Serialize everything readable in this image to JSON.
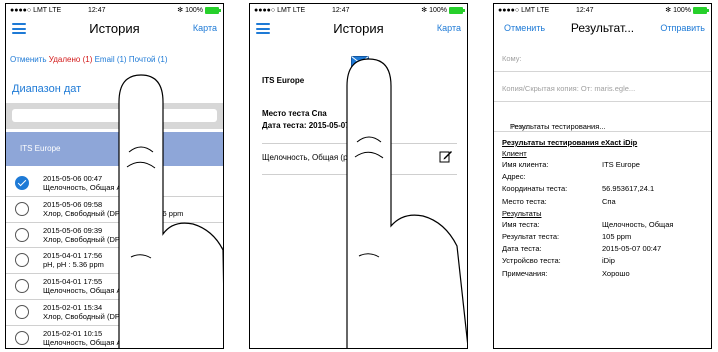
{
  "status": {
    "carrier": "●●●●○ LMT LTE",
    "time": "12:47",
    "bluetooth": "✻",
    "battery": "100%"
  },
  "screen1": {
    "title": "История",
    "map_button": "Карта",
    "filters": {
      "cancel": "Отменить",
      "deleted": "Удалено (1)",
      "email": "Email (1)",
      "mail": "Почтой (1)"
    },
    "date_range": "Диапазон дат",
    "group": "ITS Europe",
    "items": [
      {
        "date": "2015-05-06 00:47",
        "desc": "Щелочность, Общая AL : 105 ppm",
        "checked": true
      },
      {
        "date": "2015-05-06 09:58",
        "desc": "Хлор, Свободный (DPD-1) CL : 5.36 ppm",
        "checked": false
      },
      {
        "date": "2015-05-06 09:39",
        "desc": "Хлор, Свободный (DPD-1) CL : 0.51 ppm",
        "checked": false
      },
      {
        "date": "2015-04-01 17:56",
        "desc": "pH, pH : 5.36 ppm",
        "checked": false
      },
      {
        "date": "2015-04-01 17:55",
        "desc": "Щелочность, Общая AL : 0 ppm",
        "checked": false
      },
      {
        "date": "2015-02-01 15:34",
        "desc": "Хлор, Свободный (DPD-1) CL : 0.60 ppm",
        "checked": false
      },
      {
        "date": "2015-02-01 10:15",
        "desc": "Щелочность, Общая AL : 63 ppm",
        "checked": false
      }
    ]
  },
  "screen2": {
    "title": "История",
    "map_button": "Карта",
    "client": "ITS Europe",
    "place": "Место теста Спа",
    "date": "Дата теста: 2015-05-07",
    "test": "Щелочность, Общая (ppm)"
  },
  "screen3": {
    "cancel": "Отменить",
    "title": "Результат...",
    "send": "Отправить",
    "to_placeholder": "Кому:",
    "cc_placeholder": "Копия/Скрытая копия: От: maris.egle...",
    "subject_label": "Тема:",
    "subject": "Результаты тестирования...",
    "report_title": "Результаты тестирования eXact iDip",
    "client_section": "Клиент",
    "client_rows": [
      {
        "k": "Имя клиента:",
        "v": "ITS Europe"
      },
      {
        "k": "Адрес:",
        "v": ""
      },
      {
        "k": "Координаты теста:",
        "v": "56.953617,24.1"
      },
      {
        "k": "Место теста:",
        "v": "Спа"
      }
    ],
    "results_section": "Результаты",
    "result_rows": [
      {
        "k": "Имя теста:",
        "v": "Щелочность, Общая"
      },
      {
        "k": "Результат теста:",
        "v": "105 ppm"
      },
      {
        "k": "Дата теста:",
        "v": "2015-05-07 00:47"
      },
      {
        "k": "Устройсво теста:",
        "v": "iDip"
      },
      {
        "k": "Примечания:",
        "v": "Хорошо"
      }
    ]
  }
}
